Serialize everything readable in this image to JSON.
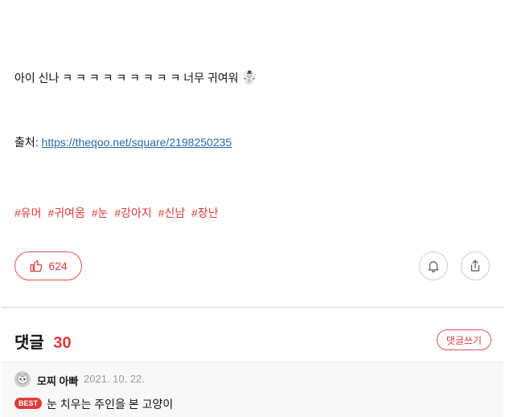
{
  "post": {
    "text_main": "아이 신나 ㅋ ㅋ ㅋ ㅋ ㅋ ㅋ ㅋ ㅋ ㅋ 너무 귀여워",
    "emoji": "☃️",
    "source_label": "출처:",
    "source_url": "https://theqoo.net/square/2198250235",
    "tags": [
      "#유머",
      "#귀여움",
      "#눈",
      "#강아지",
      "#신남",
      "#장난"
    ]
  },
  "actions": {
    "like_count": "624"
  },
  "comments": {
    "title": "댓글",
    "count": "30",
    "write_label": "댓글쓰기",
    "items": [
      {
        "author": "모찌 아빠",
        "date": "2021. 10. 22.",
        "badge": "BEST",
        "text": "눈 치우는 주인을 본 고양이"
      }
    ]
  },
  "colors": {
    "accent": "#e03a3a",
    "link": "#2c6aa5"
  }
}
